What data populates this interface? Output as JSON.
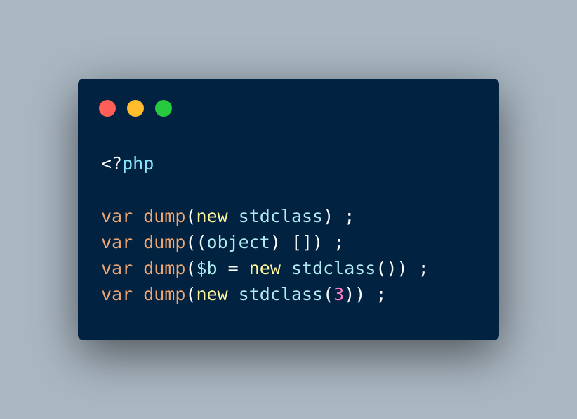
{
  "window": {
    "buttons": {
      "close_color": "#ff5f56",
      "minimize_color": "#ffbd2e",
      "maximize_color": "#27c93f"
    }
  },
  "code": {
    "lines": [
      [
        {
          "t": "<?",
          "c": "#ffffff"
        },
        {
          "t": "php",
          "c": "#8be9fd"
        }
      ],
      [],
      [
        {
          "t": "var_dump",
          "c": "#f0a671"
        },
        {
          "t": "(",
          "c": "#ffffff"
        },
        {
          "t": "new",
          "c": "#fff59d"
        },
        {
          "t": " ",
          "c": "#ffffff"
        },
        {
          "t": "stdclass",
          "c": "#b2ebf2"
        },
        {
          "t": ") ;",
          "c": "#ffffff"
        }
      ],
      [
        {
          "t": "var_dump",
          "c": "#f0a671"
        },
        {
          "t": "((",
          "c": "#ffffff"
        },
        {
          "t": "object",
          "c": "#b2ebf2"
        },
        {
          "t": ") []) ;",
          "c": "#ffffff"
        }
      ],
      [
        {
          "t": "var_dump",
          "c": "#f0a671"
        },
        {
          "t": "(",
          "c": "#ffffff"
        },
        {
          "t": "$b",
          "c": "#b2ebf2"
        },
        {
          "t": " = ",
          "c": "#ffffff"
        },
        {
          "t": "new",
          "c": "#fff59d"
        },
        {
          "t": " ",
          "c": "#ffffff"
        },
        {
          "t": "stdclass",
          "c": "#b2ebf2"
        },
        {
          "t": "()) ;",
          "c": "#ffffff"
        }
      ],
      [
        {
          "t": "var_dump",
          "c": "#f0a671"
        },
        {
          "t": "(",
          "c": "#ffffff"
        },
        {
          "t": "new",
          "c": "#fff59d"
        },
        {
          "t": " ",
          "c": "#ffffff"
        },
        {
          "t": "stdclass",
          "c": "#b2ebf2"
        },
        {
          "t": "(",
          "c": "#ffffff"
        },
        {
          "t": "3",
          "c": "#ff79c6"
        },
        {
          "t": ")) ;",
          "c": "#ffffff"
        }
      ]
    ]
  }
}
